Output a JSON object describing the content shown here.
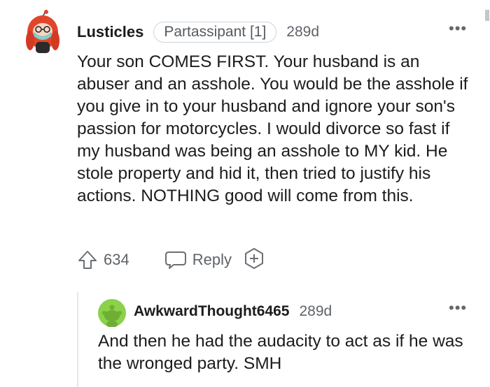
{
  "comment": {
    "username": "Lusticles",
    "flair": "Partassipant [1]",
    "age": "289d",
    "more": "•••",
    "body": "Your son COMES FIRST. Your husband is an abuser and an asshole. You would be the asshole if you give in to your husband and ignore your son's passion for motorcycles. I would divorce so fast if my husband was being an asshole to MY kid. He stole property and hid it, then tried to justify his actions. NOTHING good will come from this.",
    "votes": "634",
    "reply_label": "Reply",
    "icons": {
      "upvote": "upvote-arrow-icon",
      "reply": "speech-bubble-icon",
      "award": "award-plus-icon"
    }
  },
  "reply": {
    "username": "AwkwardThought6465",
    "age": "289d",
    "more": "•••",
    "body": "And then he had the audacity to act as if he was the wronged party. SMH"
  },
  "colors": {
    "text": "#1c1c1c",
    "muted": "#5f6368",
    "avatar_reply": "#8bd14a",
    "avatar_main_hair": "#e0452b"
  }
}
